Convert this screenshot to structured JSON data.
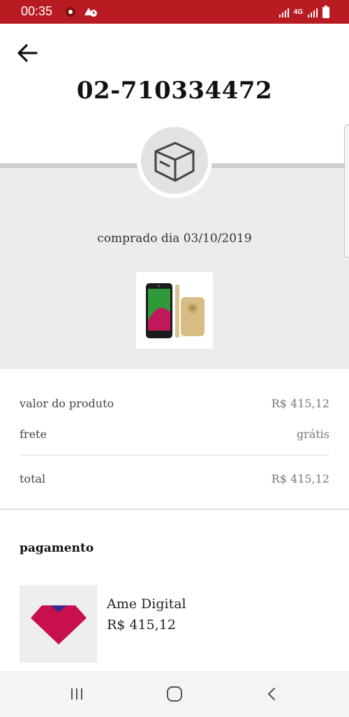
{
  "status_bar": {
    "time": "00:35",
    "network": "4G",
    "left_icons": [
      "notification-icon",
      "alarm-icon"
    ],
    "right_icons": [
      "signal-icon",
      "4g-icon",
      "signal-icon",
      "battery-icon"
    ]
  },
  "header": {
    "back_icon": "arrow-left-icon",
    "order_number": "02-710334472"
  },
  "order": {
    "status_icon": "package-box-icon",
    "purchase_date": "comprado dia 03/10/2019",
    "product_image": "smartphone-product-image"
  },
  "summary": {
    "rows": [
      {
        "label": "valor do produto",
        "value": "R$ 415,12"
      },
      {
        "label": "frete",
        "value": "grátis"
      },
      {
        "label": "total",
        "value": "R$ 415,12"
      }
    ]
  },
  "payment": {
    "title": "pagamento",
    "method_name": "Ame Digital",
    "amount": "R$ 415,12",
    "logo_icon": "ame-digital-logo"
  },
  "nav_bar": {
    "buttons": [
      "recent-apps-icon",
      "home-icon",
      "back-icon"
    ]
  },
  "colors": {
    "status_bar": "#b81c22",
    "grey_section": "#ececec",
    "ame_pink": "#c8104e",
    "ame_blue": "#3b2a8c"
  }
}
